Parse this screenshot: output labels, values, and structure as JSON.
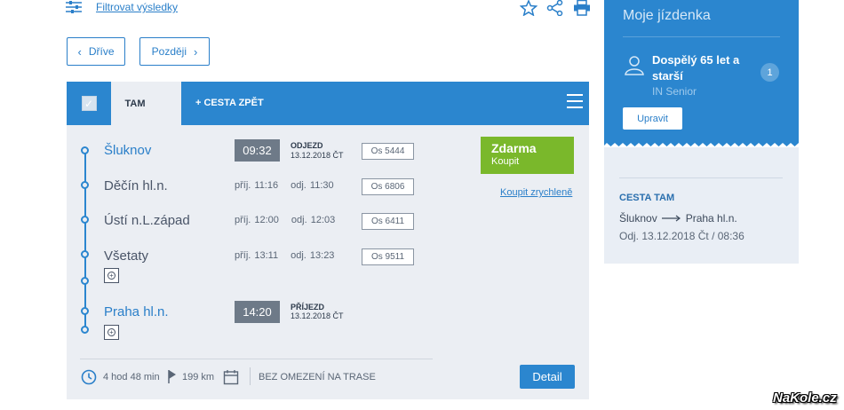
{
  "toolbar": {
    "filter_label": "Filtrovat výsledky",
    "icons": [
      "filter-icon",
      "star-icon",
      "share-icon",
      "print-icon"
    ]
  },
  "nav": {
    "earlier_label": "Dříve",
    "later_label": "Později"
  },
  "tabs": {
    "outbound_label": "TAM",
    "return_label": "+ CESTA ZPĚT"
  },
  "journey": {
    "stops": [
      {
        "name": "Šluknov",
        "time": "09:32",
        "status": "ODJEZD",
        "date": "13.12.2018 ČT",
        "train": "Os 5444"
      },
      {
        "name": "Děčín hl.n.",
        "arrival": "příj. 11:16",
        "departure": "odj. 11:30",
        "train": "Os 6806"
      },
      {
        "name": "Ústí n.L.západ",
        "arrival": "příj. 12:00",
        "departure": "odj. 12:03",
        "train": "Os 6411"
      },
      {
        "name": "Všetaty",
        "arrival": "příj. 13:11",
        "departure": "odj. 13:23",
        "train": "Os 9511"
      },
      {
        "name": "Praha hl.n.",
        "time": "14:20",
        "status": "PŘÍJEZD",
        "date": "13.12.2018 ČT"
      }
    ],
    "buy": {
      "price": "Zdarma",
      "label": "Koupit",
      "quick_link": "Koupit zrychleně"
    },
    "footer": {
      "duration": "4 hod 48 min",
      "distance": "199 km",
      "restriction": "BEZ OMEZENÍ NA TRASE",
      "detail_label": "Detail"
    }
  },
  "ticket": {
    "title": "Moje jízdenka",
    "passenger_type": "Dospělý 65 let a starší",
    "passenger_tariff": "IN Senior",
    "passenger_count": "1",
    "edit_label": "Upravit",
    "direction_title": "CESTA TAM",
    "route_from": "Šluknov",
    "route_to": "Praha hl.n.",
    "departure_line": "Odj. 13.12.2018 Čt / 08:36"
  },
  "watermark": "NaKole.cz",
  "colors": {
    "primary_blue": "#2b86cf",
    "buy_green": "#7ab82b",
    "card_bg": "#ebeef3",
    "time_badge": "#6e7a88"
  }
}
